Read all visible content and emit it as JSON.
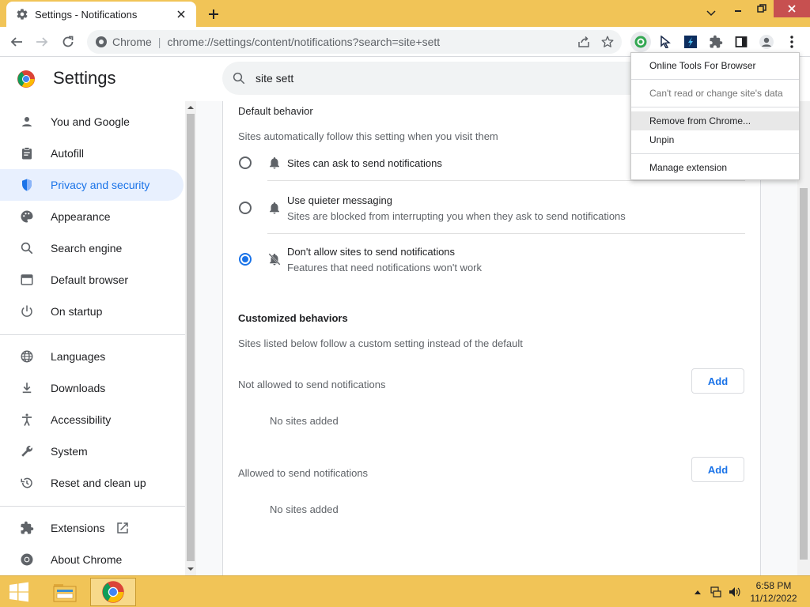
{
  "browser": {
    "tab_title": "Settings - Notifications",
    "omnibox_site": "Chrome",
    "omnibox_url": "chrome://settings/content/notifications?search=site+sett"
  },
  "settings": {
    "title": "Settings",
    "search_value": "site sett"
  },
  "sidebar": {
    "items": [
      {
        "label": "You and Google",
        "icon": "person-icon"
      },
      {
        "label": "Autofill",
        "icon": "clipboard-icon"
      },
      {
        "label": "Privacy and security",
        "icon": "shield-icon"
      },
      {
        "label": "Appearance",
        "icon": "palette-icon"
      },
      {
        "label": "Search engine",
        "icon": "search-icon"
      },
      {
        "label": "Default browser",
        "icon": "browser-icon"
      },
      {
        "label": "On startup",
        "icon": "power-icon"
      },
      {
        "label": "Languages",
        "icon": "globe-icon"
      },
      {
        "label": "Downloads",
        "icon": "download-icon"
      },
      {
        "label": "Accessibility",
        "icon": "accessibility-icon"
      },
      {
        "label": "System",
        "icon": "wrench-icon"
      },
      {
        "label": "Reset and clean up",
        "icon": "restore-icon"
      },
      {
        "label": "Extensions",
        "icon": "puzzle-icon"
      },
      {
        "label": "About Chrome",
        "icon": "chrome-icon"
      }
    ]
  },
  "main": {
    "default_behavior_title": "Default behavior",
    "default_behavior_desc": "Sites automatically follow this setting when you visit them",
    "options": [
      {
        "label": "Sites can ask to send notifications",
        "desc": "",
        "selected": false
      },
      {
        "label": "Use quieter messaging",
        "desc": "Sites are blocked from interrupting you when they ask to send notifications",
        "selected": false
      },
      {
        "label": "Don't allow sites to send notifications",
        "desc": "Features that need notifications won't work",
        "selected": true
      }
    ],
    "customized_title": "Customized behaviors",
    "customized_desc": "Sites listed below follow a custom setting instead of the default",
    "not_allowed_label": "Not allowed to send notifications",
    "allowed_label": "Allowed to send notifications",
    "add_label": "Add",
    "no_sites": "No sites added"
  },
  "ext_menu": {
    "items": [
      "Online Tools For Browser",
      "Can't read or change site's data",
      "Remove from Chrome...",
      "Unpin",
      "Manage extension"
    ]
  },
  "taskbar": {
    "time": "6:58 PM",
    "date": "11/12/2022"
  },
  "colors": {
    "accent": "#1a73e8",
    "titlebar": "#f1c457"
  }
}
